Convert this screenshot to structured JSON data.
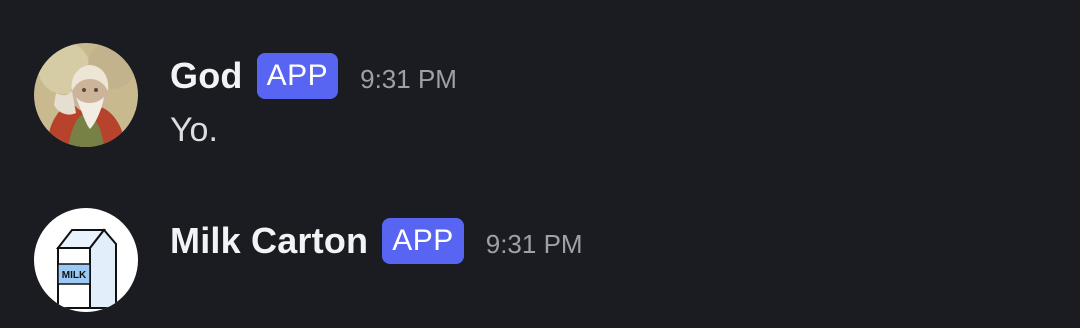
{
  "messages": [
    {
      "username": "God",
      "badge": "APP",
      "timestamp": "9:31 PM",
      "content": "Yo."
    },
    {
      "username": "Milk Carton",
      "badge": "APP",
      "timestamp": "9:31 PM",
      "content": ""
    }
  ],
  "avatars": {
    "milk_carton_text": "MILK"
  },
  "colors": {
    "background": "#1b1c21",
    "badge": "#5865f2",
    "username": "#f2f3f5",
    "timestamp": "#9da0a8",
    "message_text": "#dbdee1"
  }
}
